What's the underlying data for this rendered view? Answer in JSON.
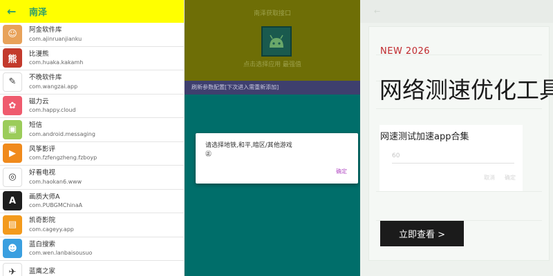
{
  "list_panel": {
    "title": "南泽",
    "back_icon": "arrow-left-icon",
    "accent": "#2e9e6a",
    "bar_color": "#ffff00",
    "apps": [
      {
        "name": "阿金软件库",
        "package": "com.ajinruanjianku",
        "icon": "avatar-icon",
        "color": "#e8a25a"
      },
      {
        "name": "比漫熊",
        "package": "com.huaka.kakamh",
        "icon": "bear-icon",
        "color": "#c33a2c"
      },
      {
        "name": "不晚软件库",
        "package": "com.wangzai.app",
        "icon": "chat-icon",
        "color": "#ffffff"
      },
      {
        "name": "磁力云",
        "package": "com.happy.cloud",
        "icon": "flower-icon",
        "color": "#ef5b6e"
      },
      {
        "name": "短信",
        "package": "com.android.messaging",
        "icon": "android-icon",
        "color": "#9bcc5a"
      },
      {
        "name": "风筝影评",
        "package": "com.fzfengzheng.fzboyp",
        "icon": "play-icon",
        "color": "#f08a1c"
      },
      {
        "name": "好看电视",
        "package": "com.haokan6.www",
        "icon": "ring-icon",
        "color": "#ffffff"
      },
      {
        "name": "画质大师A",
        "package": "com.PUBGMChinaA",
        "icon": "letter-a-icon",
        "color": "#1e1e1e"
      },
      {
        "name": "凯奇影院",
        "package": "com.cageyy.app",
        "icon": "film-icon",
        "color": "#f39a1c"
      },
      {
        "name": "蓝白搜索",
        "package": "com.wen.lanbaisousuo",
        "icon": "doraemon-icon",
        "color": "#3a9fe0"
      },
      {
        "name": "蓝鹰之家",
        "package": "",
        "icon": "bird-icon",
        "color": "#ffffff"
      }
    ]
  },
  "dialog_panel": {
    "title": "南泽获取接口",
    "pick_label": "点击选择应用 最强值",
    "band_text": "刷新参数配置[下次进入需重新添加]",
    "dialog_message": "请选择地铁,和平,暗区/其他游戏\n㊣",
    "dialog_ok": "确定",
    "app_icon": "android-icon",
    "ok_color": "#b44fc5"
  },
  "ad_panel": {
    "tag": "NEW 2026",
    "headline": "网络测速优化工具",
    "card_title": "网速测试加速app合集",
    "card_field_value": "60",
    "card_button_1": "取消",
    "card_button_2": "确定",
    "cta_label": "立即查看 >",
    "tag_color": "#c0282c"
  }
}
